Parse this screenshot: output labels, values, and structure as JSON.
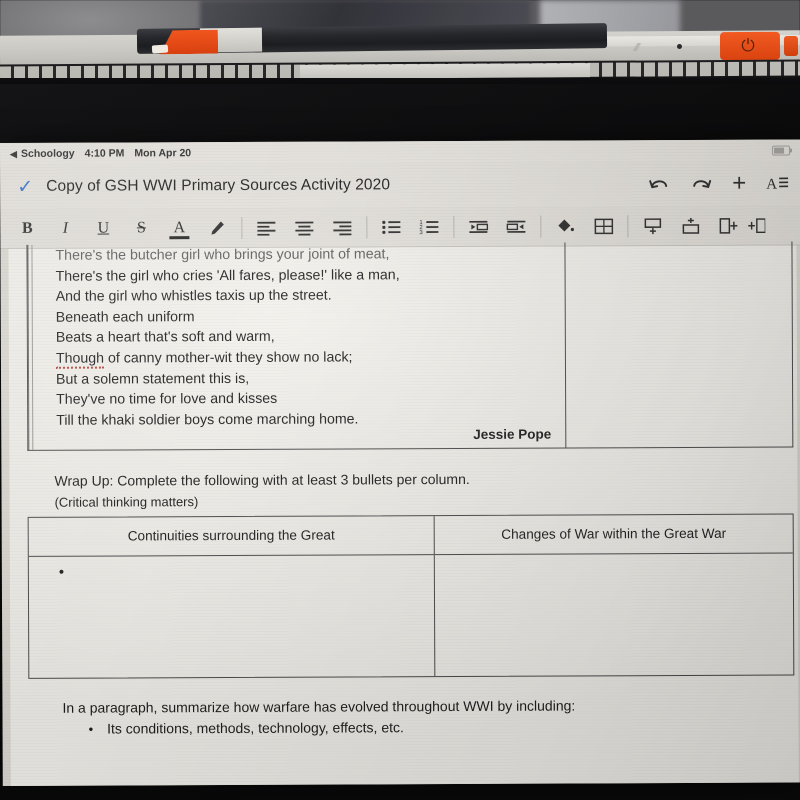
{
  "device": {
    "stylus_label": "stylus",
    "power_button_glyph": "⏻"
  },
  "status_bar": {
    "back_caret": "◀",
    "back_app": "Schoology",
    "time": "4:10 PM",
    "date": "Mon Apr 20"
  },
  "title_bar": {
    "saved_check": "✓",
    "document_title": "Copy of GSH WWI Primary Sources Activity 2020",
    "actions": [
      {
        "name": "undo-icon",
        "glyph": "↶"
      },
      {
        "name": "redo-icon",
        "glyph": "↷"
      },
      {
        "name": "insert-icon",
        "glyph": "+"
      },
      {
        "name": "text-format-icon",
        "glyph": "A"
      }
    ]
  },
  "toolbar": {
    "bold_label": "B",
    "italic_label": "I",
    "underline_label": "U",
    "strikethrough_label": "S",
    "text_color_label": "A",
    "highlighter_label": "✎",
    "align_left_label": "≡",
    "align_center_label": "≡",
    "align_right_label": "≡",
    "bulleted_list_label": "⋮≡",
    "numbered_list_label": "⒈≡",
    "outdent_label": "⇤",
    "indent_label": "⇥",
    "fill_color_label": "◆",
    "table_label": "⊞",
    "insert_row_below_label": "⊟",
    "insert_row_above_label": "⊞",
    "insert_column_left_label": "⊩",
    "insert_column_right_label": "⊪"
  },
  "document": {
    "poem": {
      "lines": [
        "There's the butcher girl who brings your joint of meat,",
        "There's the girl who cries 'All fares, please!' like a man,",
        "And the girl who whistles taxis up the street.",
        "Beneath each uniform",
        "Beats a heart that's soft and warm,"
      ],
      "line_spell_prefix": "Though",
      "line_spell_rest": " of canny mother-wit they show no lack;",
      "lines_after": [
        "But a solemn statement this is,",
        "They've no time for love and kisses",
        "Till the khaki soldier boys come marching home."
      ],
      "author": "Jessie Pope"
    },
    "wrap_up": {
      "instruction": "Wrap Up: Complete the following with at least 3 bullets per column.",
      "sub_note": "(Critical thinking matters)",
      "table": {
        "headers": [
          "Continuities surrounding the Great",
          "Changes of War within the Great War"
        ],
        "cells": [
          {
            "bullet": "•"
          },
          {
            "bullet": ""
          }
        ]
      }
    },
    "closing": {
      "paragraph_prompt": "In a paragraph, summarize how warfare has evolved throughout WWI by including:",
      "bullet_glyph": "•",
      "bullet_text": "Its conditions, methods, technology, effects, etc."
    }
  },
  "colors": {
    "accent_blue": "#2f6fd0",
    "spellcheck_red": "#b8453e",
    "page_background": "#f3f1ec",
    "toolbar_background": "#e4e1db",
    "device_orange": "#ef5a22"
  }
}
